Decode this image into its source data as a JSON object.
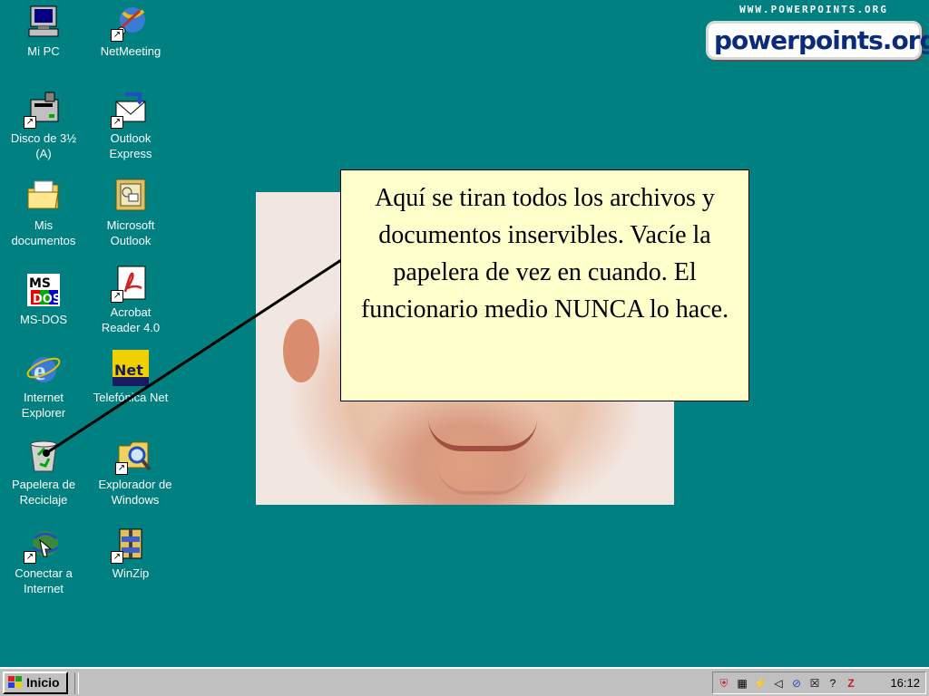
{
  "logo": {
    "url": "WWW.POWERPOINTS.ORG",
    "brand": "powerpoints.org"
  },
  "icons": [
    {
      "label": "Mi PC",
      "name": "my-computer-icon"
    },
    {
      "label": "NetMeeting",
      "name": "netmeeting-icon"
    },
    {
      "label": "Disco de 3½\n(A)",
      "name": "floppy-drive-icon"
    },
    {
      "label": "Outlook\nExpress",
      "name": "outlook-express-icon"
    },
    {
      "label": "Mis\ndocumentos",
      "name": "my-documents-icon"
    },
    {
      "label": "Microsoft\nOutlook",
      "name": "microsoft-outlook-icon"
    },
    {
      "label": "MS-DOS",
      "name": "ms-dos-icon"
    },
    {
      "label": "Acrobat\nReader 4.0",
      "name": "acrobat-reader-icon"
    },
    {
      "label": "Internet\nExplorer",
      "name": "internet-explorer-icon"
    },
    {
      "label": "Telefónica Net",
      "name": "telefonica-net-icon"
    },
    {
      "label": "Papelera de\nReciclaje",
      "name": "recycle-bin-icon"
    },
    {
      "label": "Explorador de\nWindows",
      "name": "windows-explorer-icon"
    },
    {
      "label": "Conectar a\nInternet",
      "name": "connect-internet-icon"
    },
    {
      "label": "WinZip",
      "name": "winzip-icon"
    }
  ],
  "callout": {
    "text": "Aquí se tiran todos los archivos y documentos inservibles. Vacíe la papelera de vez en cuando. El funcionario medio NUNCA lo hace."
  },
  "taskbar": {
    "start_label": "Inicio",
    "clock": "16:12"
  }
}
